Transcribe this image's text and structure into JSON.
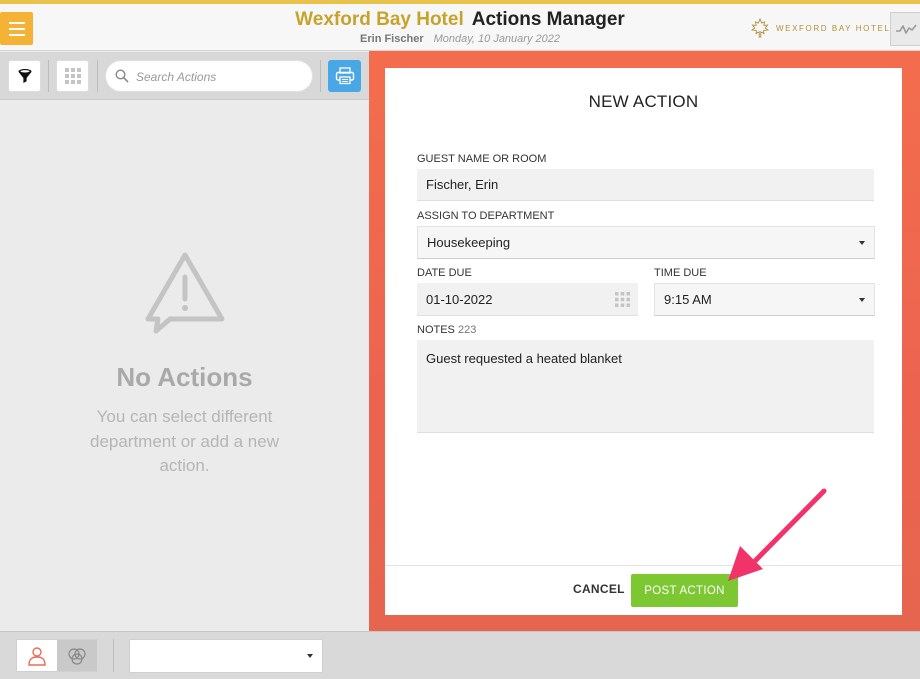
{
  "header": {
    "hotel_name": "Wexford Bay Hotel",
    "app_name": "Actions Manager",
    "user_name": "Erin Fischer",
    "date": "Monday, 10 January 2022",
    "logo_text": "WEXFORD BAY HOTEL",
    "accent_color": "#c7a32c",
    "menu_icon": "hamburger-icon",
    "activity_icon": "activity-pulse-icon"
  },
  "toolbar": {
    "filter_icon": "funnel-icon",
    "grid_icon": "grid-icon",
    "search_placeholder": "Search Actions",
    "print_icon": "printer-icon",
    "print_color": "#4aa7e6"
  },
  "empty_state": {
    "icon": "warning-message-icon",
    "title": "No Actions",
    "message": "You can select different department or add a new action."
  },
  "form": {
    "title": "NEW ACTION",
    "guest_label": "GUEST NAME OR ROOM",
    "guest_value": "Fischer, Erin",
    "department_label": "ASSIGN TO DEPARTMENT",
    "department_value": "Housekeeping",
    "date_label": "DATE DUE",
    "date_value": "01-10-2022",
    "time_label": "TIME DUE",
    "time_value": "9:15 AM",
    "notes_label": "NOTES",
    "notes_count": "223",
    "notes_value": "Guest requested a heated blanket",
    "cancel_label": "CANCEL",
    "post_label": "POST ACTION",
    "post_color": "#7dc832",
    "pane_color": "#f36d4d"
  },
  "annotation": {
    "arrow_color": "#f2336b"
  },
  "bottom_bar": {
    "person_icon": "person-icon",
    "group_icon": "circles-icon",
    "department_select_value": ""
  }
}
